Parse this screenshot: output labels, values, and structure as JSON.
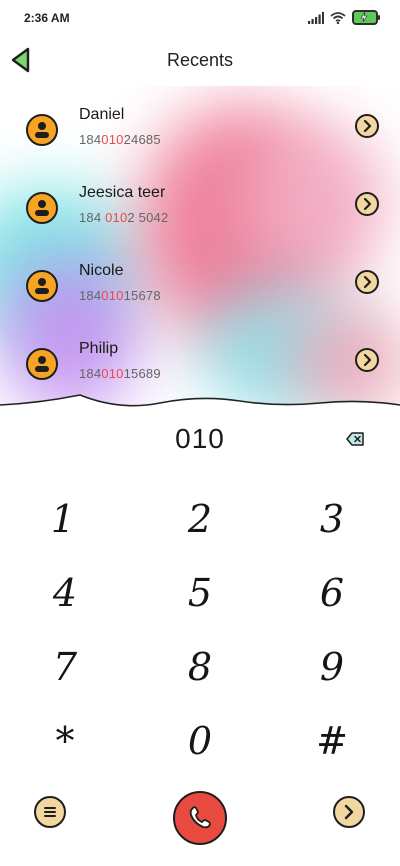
{
  "status_bar": {
    "time": "2:36 AM"
  },
  "header": {
    "title": "Recents"
  },
  "contacts": [
    {
      "name": "Daniel",
      "number_parts": [
        "184",
        "010",
        "24685"
      ]
    },
    {
      "name": "Jeesica teer",
      "number_parts": [
        "184 ",
        "010",
        "2 5042"
      ]
    },
    {
      "name": "Nicole",
      "number_parts": [
        "184",
        "010",
        "15678"
      ]
    },
    {
      "name": "Philip",
      "number_parts": [
        "184",
        "010",
        "15689"
      ]
    }
  ],
  "dial": {
    "input": "010"
  },
  "keypad": [
    "1",
    "2",
    "3",
    "4",
    "5",
    "6",
    "7",
    "8",
    "9",
    "*",
    "0",
    "#"
  ],
  "colors": {
    "avatar": "#f7a324",
    "accent": "#e84b4b",
    "call": "#e84a3f",
    "chip": "#f2d7a0"
  }
}
